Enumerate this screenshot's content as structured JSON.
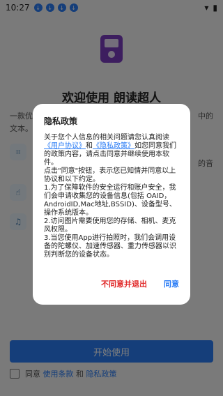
{
  "status_bar": {
    "time": "10:27"
  },
  "app": {
    "welcome_title": "欢迎使用 朗读超人",
    "intro_text": "一款优",
    "intro_tail": "中的",
    "intro_line2": "文本。",
    "bg_right_text": "的音"
  },
  "start_button": {
    "label": "开始使用"
  },
  "agree": {
    "prefix": "同意",
    "terms": "使用条款",
    "and": "和",
    "privacy": "隐私政策"
  },
  "dialog": {
    "title": "隐私政策",
    "p1_before": "关于您个人信息的相关问题请您认真阅读",
    "link_user": "《用户协议》",
    "p1_and": "和",
    "link_privacy": "《隐私政策》",
    "p1_after": "如您同意我们的政策内容，请点击同意并继续使用本软件。",
    "p2": "点击\"同意\"按钮，表示您已知情并同意以上协议和以下约定。",
    "p3": "1.为了保障软件的安全运行和账户安全，我们会申请收集您的设备信息(包括 OAID，AndroidID,Mac地址,BSSID)、设备型号、操作系统版本。",
    "p4": "2.访问图片需要使用您的存储、相机、麦克风权限。",
    "p5": "3.当您使用App进行拍照时，我们会调用设备的陀螺仪、加速传感器、重力传感器以识别判断您的设备状态。",
    "reject_label": "不同意并退出",
    "accept_label": "同意"
  },
  "colors": {
    "accent": "#2a7cf5",
    "reject": "#e12b2b",
    "logo": "#7b3dbf"
  }
}
